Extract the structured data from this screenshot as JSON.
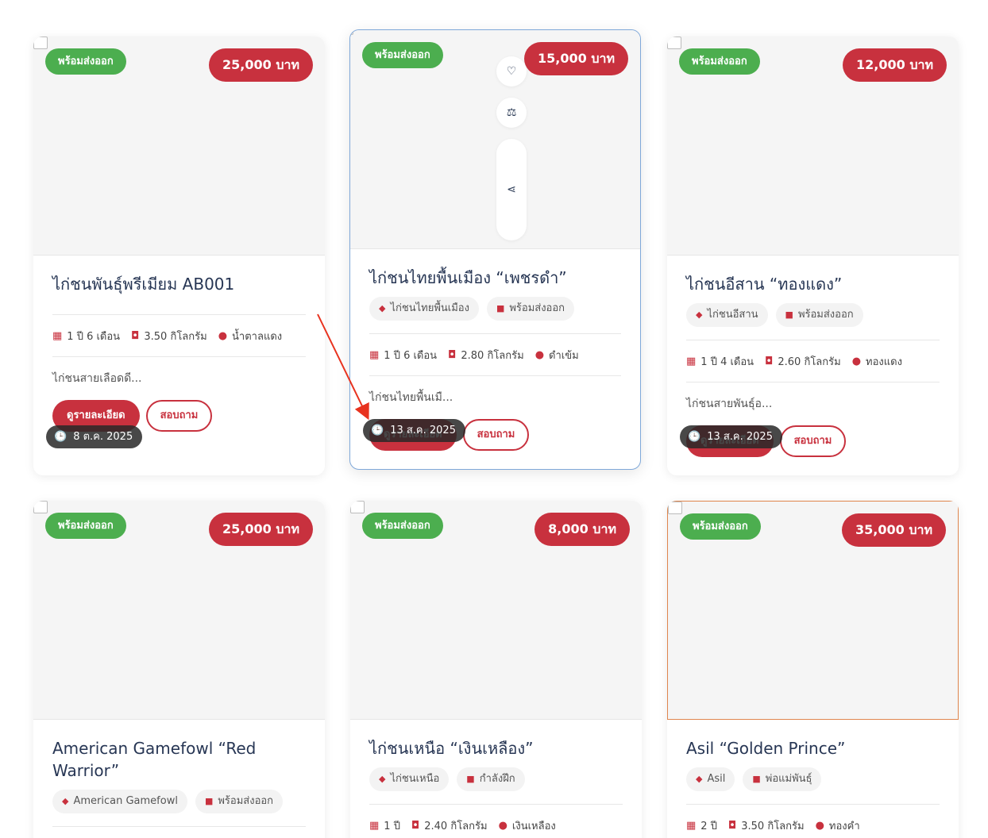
{
  "cards": [
    {
      "badge": "พร้อมส่งออก",
      "price": "25,000 บาท",
      "title": "ไก่ชนพันธุ์พรีเมียม AB001",
      "tags": [],
      "age": "1 ปี 6 เดือน",
      "weight": "3.50 กิโลกรัม",
      "color": "น้ำตาลแดง",
      "desc": "ไก่ชนสายเลือดดี...",
      "detail_btn": "ดูรายละเอียด",
      "ask_btn": "สอบถาม",
      "date": "8 ต.ค. 2025"
    },
    {
      "badge": "พร้อมส่งออก",
      "price": "15,000 บาท",
      "title": "ไก่ชนไทยพื้นเมือง “เพชรดำ”",
      "tags": [
        "ไก่ชนไทยพื้นเมือง",
        "พร้อมส่งออก"
      ],
      "age": "1 ปี 6 เดือน",
      "weight": "2.80 กิโลกรัม",
      "color": "ดำเข้ม",
      "desc": "ไก่ชนไทยพื้นเมื...",
      "detail_btn": "ดูรายละเอียด",
      "ask_btn": "สอบถาม",
      "date": "13 ส.ค. 2025"
    },
    {
      "badge": "พร้อมส่งออก",
      "price": "12,000 บาท",
      "title": "ไก่ชนอีสาน “ทองแดง”",
      "tags": [
        "ไก่ชนอีสาน",
        "พร้อมส่งออก"
      ],
      "age": "1 ปี 4 เดือน",
      "weight": "2.60 กิโลกรัม",
      "color": "ทองแดง",
      "desc": "ไก่ชนสายพันธุ์อ...",
      "detail_btn": "ดูรายละเอียด",
      "ask_btn": "สอบถาม",
      "date": "13 ส.ค. 2025"
    },
    {
      "badge": "พร้อมส่งออก",
      "price": "25,000 บาท",
      "title": "American Gamefowl “Red Warrior”",
      "tags": [
        "American Gamefowl",
        "พร้อมส่งออก"
      ]
    },
    {
      "badge": "พร้อมส่งออก",
      "price": "8,000 บาท",
      "title": "ไก่ชนเหนือ “เงินเหลือง”",
      "tags": [
        "ไก่ชนเหนือ",
        "กำลังฝึก"
      ],
      "age": "1 ปี",
      "weight": "2.40 กิโลกรัม",
      "color": "เงินเหลือง"
    },
    {
      "badge": "พร้อมส่งออก",
      "price": "35,000 บาท",
      "title": "Asil “Golden Prince”",
      "tags": [
        "Asil",
        "พ่อแม่พันธุ์"
      ],
      "age": "2 ปี",
      "weight": "3.50 กิโลกรัม",
      "color": "ทองคำ"
    }
  ],
  "icons": {
    "wishlist": "heart-icon",
    "compare": "scale-icon",
    "share": "share-icon",
    "tag": "tag-icon",
    "category": "folder-icon",
    "age": "calendar-icon",
    "weight": "weight-icon",
    "color": "palette-icon",
    "date": "clock-icon"
  },
  "colors": {
    "ready_badge": "#4cae4f",
    "price_badge": "#c8313e",
    "annotation_arrow": "#e8321e"
  }
}
